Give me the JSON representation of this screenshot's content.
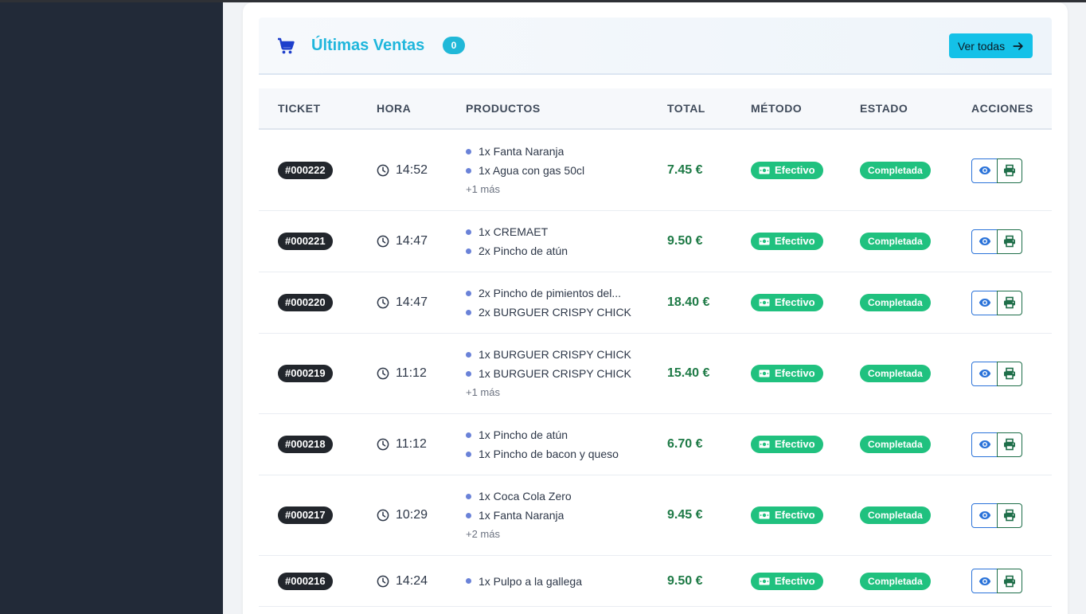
{
  "header": {
    "title": "Últimas Ventas",
    "count": "0",
    "view_all_label": "Ver todas",
    "icon": "cart-icon",
    "accent": "#1fb6dc"
  },
  "columns": {
    "ticket": "TICKET",
    "hora": "HORA",
    "productos": "PRODUCTOS",
    "total": "TOTAL",
    "metodo": "MÉTODO",
    "estado": "ESTADO",
    "acciones": "ACCIONES"
  },
  "sales": [
    {
      "ticket": "#000222",
      "time": "14:52",
      "products": [
        "1x Fanta Naranja",
        "1x Agua con gas 50cl"
      ],
      "more": "+1 más",
      "total": "7.45 €",
      "method": "Efectivo",
      "status": "Completada"
    },
    {
      "ticket": "#000221",
      "time": "14:47",
      "products": [
        "1x CREMAET",
        "2x Pincho de atún"
      ],
      "more": "",
      "total": "9.50 €",
      "method": "Efectivo",
      "status": "Completada"
    },
    {
      "ticket": "#000220",
      "time": "14:47",
      "products": [
        "2x Pincho de pimientos del...",
        "2x BURGUER CRISPY CHICK"
      ],
      "more": "",
      "total": "18.40 €",
      "method": "Efectivo",
      "status": "Completada"
    },
    {
      "ticket": "#000219",
      "time": "11:12",
      "products": [
        "1x BURGUER CRISPY CHICK",
        "1x BURGUER CRISPY CHICK"
      ],
      "more": "+1 más",
      "total": "15.40 €",
      "method": "Efectivo",
      "status": "Completada"
    },
    {
      "ticket": "#000218",
      "time": "11:12",
      "products": [
        "1x Pincho de atún",
        "1x Pincho de bacon y queso"
      ],
      "more": "",
      "total": "6.70 €",
      "method": "Efectivo",
      "status": "Completada"
    },
    {
      "ticket": "#000217",
      "time": "10:29",
      "products": [
        "1x Coca Cola Zero",
        "1x Fanta Naranja"
      ],
      "more": "+2 más",
      "total": "9.45 €",
      "method": "Efectivo",
      "status": "Completada"
    },
    {
      "ticket": "#000216",
      "time": "14:24",
      "products": [
        "1x Pulpo a la gallega"
      ],
      "more": "",
      "total": "9.50 €",
      "method": "Efectivo",
      "status": "Completada"
    }
  ],
  "colors": {
    "sidebar": "#222a38",
    "total": "#1e7a46",
    "badge_green": "#20c17f",
    "button_cyan": "#14c1e8"
  }
}
